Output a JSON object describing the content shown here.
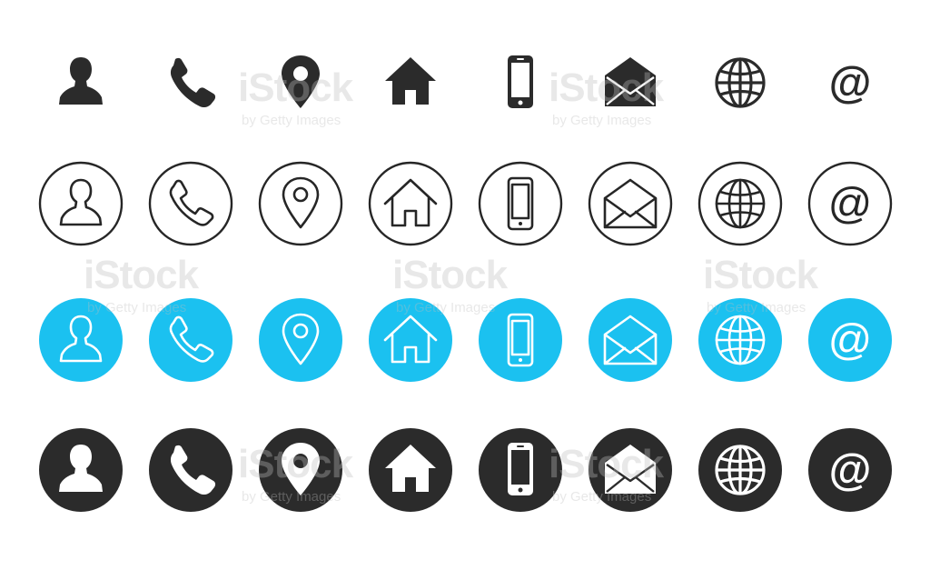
{
  "colors": {
    "black": "#2b2b2b",
    "outline": "#262626",
    "blue": "#1bc1f0",
    "white": "#ffffff"
  },
  "icons": [
    "user-icon",
    "phone-icon",
    "location-pin-icon",
    "home-icon",
    "mobile-phone-icon",
    "envelope-icon",
    "globe-icon",
    "at-sign-icon"
  ],
  "rows": [
    {
      "name": "plain-row",
      "style": "plain"
    },
    {
      "name": "outline-row",
      "style": "outline"
    },
    {
      "name": "blue-row",
      "style": "blue"
    },
    {
      "name": "dark-row",
      "style": "dark"
    }
  ],
  "watermark": {
    "brand": "iStock",
    "credit": "by Getty Images"
  }
}
